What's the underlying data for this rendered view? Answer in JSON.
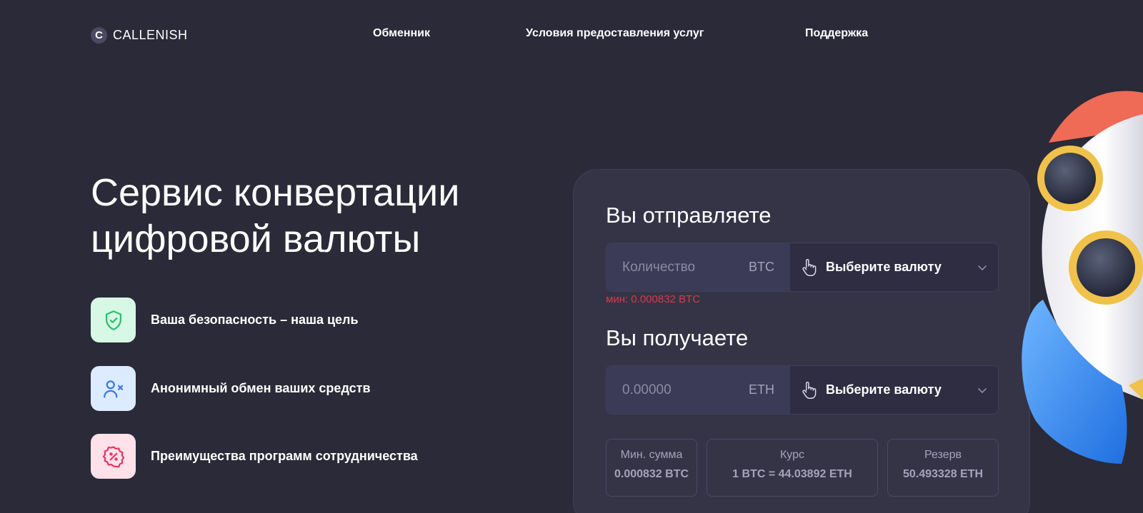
{
  "header": {
    "logo_letter": "C",
    "logo_text": "CALLENISH",
    "nav": [
      "Обменник",
      "Условия предоставления услуг",
      "Поддержка"
    ]
  },
  "hero": {
    "title": "Сервис конвертации цифровой валюты",
    "features": [
      {
        "icon": "shield-check-icon",
        "text": "Ваша безопасность – наша цель",
        "bg": "#d6f8e4",
        "color": "#2fbf6b"
      },
      {
        "icon": "user-x-icon",
        "text": "Анонимный обмен ваших средств",
        "bg": "#dcebff",
        "color": "#3b7be0"
      },
      {
        "icon": "percent-badge-icon",
        "text": "Преимущества программ сотрудничества",
        "bg": "#ffe1ea",
        "color": "#e23a66"
      }
    ]
  },
  "exchange": {
    "send": {
      "title": "Вы отправляете",
      "placeholder": "Количество",
      "currency": "BTC",
      "select_label": "Выберите валюту",
      "min_note": "мин: 0.000832 BTC"
    },
    "receive": {
      "title": "Вы получаете",
      "placeholder": "0.00000",
      "currency": "ETH",
      "select_label": "Выберите валюту"
    },
    "stats": [
      {
        "label": "Мин. сумма",
        "value": "0.000832 BTC"
      },
      {
        "label": "Курс",
        "value": "1 BTC = 44.03892 ETH"
      },
      {
        "label": "Резерв",
        "value": "50.493328 ETH"
      }
    ]
  },
  "colors": {
    "background": "#2a2a38",
    "card": "#353447",
    "error": "#d63a4a"
  }
}
